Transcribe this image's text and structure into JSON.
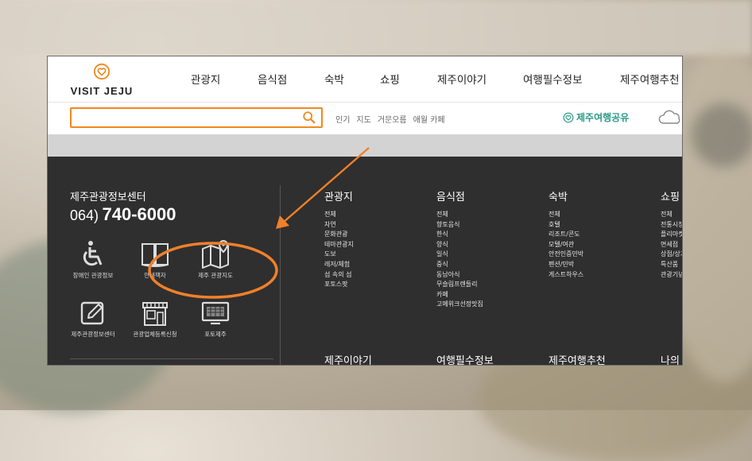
{
  "brand": {
    "logo_text": "VISIT JEJU",
    "logo_color": "#f0891f"
  },
  "nav": {
    "items": [
      "관광지",
      "음식점",
      "숙박",
      "쇼핑",
      "제주이야기",
      "여행필수정보",
      "제주여행추천"
    ]
  },
  "search": {
    "value": "",
    "placeholder": ""
  },
  "keywords": [
    "인기",
    "지도",
    "거문오름",
    "애월 카페"
  ],
  "share_label": "제주여행공유",
  "info_center": {
    "title": "제주관광정보센터",
    "phone_prefix": "064)",
    "phone_number": "740-6000"
  },
  "quick_links": [
    {
      "label": "장애인 관광정보",
      "icon": "wheelchair-icon"
    },
    {
      "label": "안내책자",
      "icon": "book-icon"
    },
    {
      "label": "제주 관광지도",
      "icon": "map-icon"
    },
    {
      "label": "제주관광정보센터",
      "icon": "edit-icon"
    },
    {
      "label": "관광업체등록신청",
      "icon": "store-icon"
    },
    {
      "label": "포토제주",
      "icon": "monitor-icon"
    }
  ],
  "menu_columns": [
    {
      "title": "관광지",
      "items": [
        "전체",
        "자연",
        "문화관광",
        "테마관광지",
        "도보",
        "레저/체험",
        "섬 속의 섬",
        "포토스팟"
      ]
    },
    {
      "title": "음식점",
      "items": [
        "전체",
        "향토음식",
        "한식",
        "양식",
        "일식",
        "중식",
        "동남아식",
        "무슬림프렌들리",
        "카페",
        "고메위크선정맛집"
      ]
    },
    {
      "title": "숙박",
      "items": [
        "전체",
        "호텔",
        "리조트/콘도",
        "모텔/여관",
        "안전인증민박",
        "펜션/민박",
        "게스트하우스"
      ]
    },
    {
      "title": "쇼핑",
      "items": [
        "전체",
        "전통시장",
        "플리마켓",
        "면세점",
        "상점/상가",
        "특산품",
        "관광기념품"
      ]
    }
  ],
  "bottom_titles": [
    "제주이야기",
    "여행필수정보",
    "제주여행추천",
    "나의"
  ],
  "annotation": {
    "color": "#f0802a"
  }
}
